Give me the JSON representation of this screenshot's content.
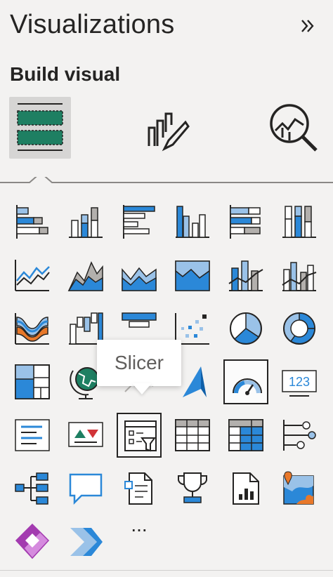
{
  "header": {
    "title": "Visualizations",
    "collapse_icon": "double-chevron-right-icon"
  },
  "build": {
    "label": "Build visual"
  },
  "modes": [
    {
      "name": "build-visual-mode",
      "icon": "table-fields-icon",
      "active": true
    },
    {
      "name": "format-visual-mode",
      "icon": "paintbrush-chart-icon",
      "active": false
    },
    {
      "name": "analytics-mode",
      "icon": "magnifier-chart-icon",
      "active": false
    }
  ],
  "visuals": [
    "stacked-bar-chart-icon",
    "stacked-column-chart-icon",
    "clustered-bar-chart-icon",
    "clustered-column-chart-icon",
    "100-stacked-bar-chart-icon",
    "100-stacked-column-chart-icon",
    "line-chart-icon",
    "area-chart-icon",
    "stacked-area-chart-icon",
    "100-stacked-area-chart-icon",
    "line-stacked-column-chart-icon",
    "line-clustered-column-chart-icon",
    "ribbon-chart-icon",
    "waterfall-chart-icon",
    "funnel-chart-icon",
    "scatter-chart-icon",
    "pie-chart-icon",
    "donut-chart-icon",
    "treemap-icon",
    "map-icon",
    "filled-map-icon",
    "azure-map-icon",
    "gauge-icon",
    "card-icon",
    "multi-row-card-icon",
    "kpi-icon",
    "slicer-icon",
    "table-icon",
    "matrix-icon",
    "key-influencers-icon",
    "decomposition-tree-icon",
    "qa-icon",
    "smart-narrative-icon",
    "goals-icon",
    "paginated-report-icon",
    "arcgis-map-icon",
    "power-apps-icon",
    "power-automate-icon"
  ],
  "more": {
    "label": "..."
  },
  "tooltip": {
    "text": "Slicer"
  },
  "colors": {
    "accent_blue": "#2b88d8",
    "light_blue": "#9ac2e8",
    "gray": "#8a8886",
    "dark": "#252423",
    "green": "#1e7f62",
    "purple": "#a33bb0",
    "orange": "#e8782a"
  }
}
